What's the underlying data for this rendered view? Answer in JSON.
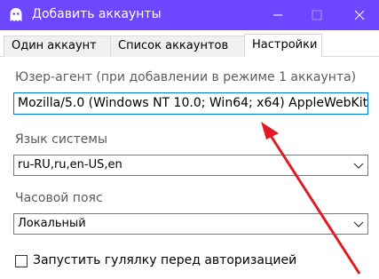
{
  "window": {
    "title": "Добавить аккаунты",
    "accent_color": "#6c47ff",
    "icon": "ghost-icon"
  },
  "tabs": [
    {
      "label": "Один аккаунт",
      "active": false
    },
    {
      "label": "Список аккаунтов",
      "active": false
    },
    {
      "label": "Настройки",
      "active": true
    }
  ],
  "settings": {
    "user_agent_label": "Юзер-агент (при добавлении в режиме 1 аккаунта)",
    "user_agent_value": "Mozilla/5.0 (Windows NT 10.0; Win64; x64) AppleWebKit",
    "language_label": "Язык системы",
    "language_value": "ru-RU,ru,en-US,en",
    "timezone_label": "Часовой пояс",
    "timezone_value": "Локальный",
    "run_before_auth_label": "Запустить гулялку перед авторизацией",
    "run_before_auth_checked": false
  },
  "annotation": {
    "arrow_color": "#e01b24"
  }
}
